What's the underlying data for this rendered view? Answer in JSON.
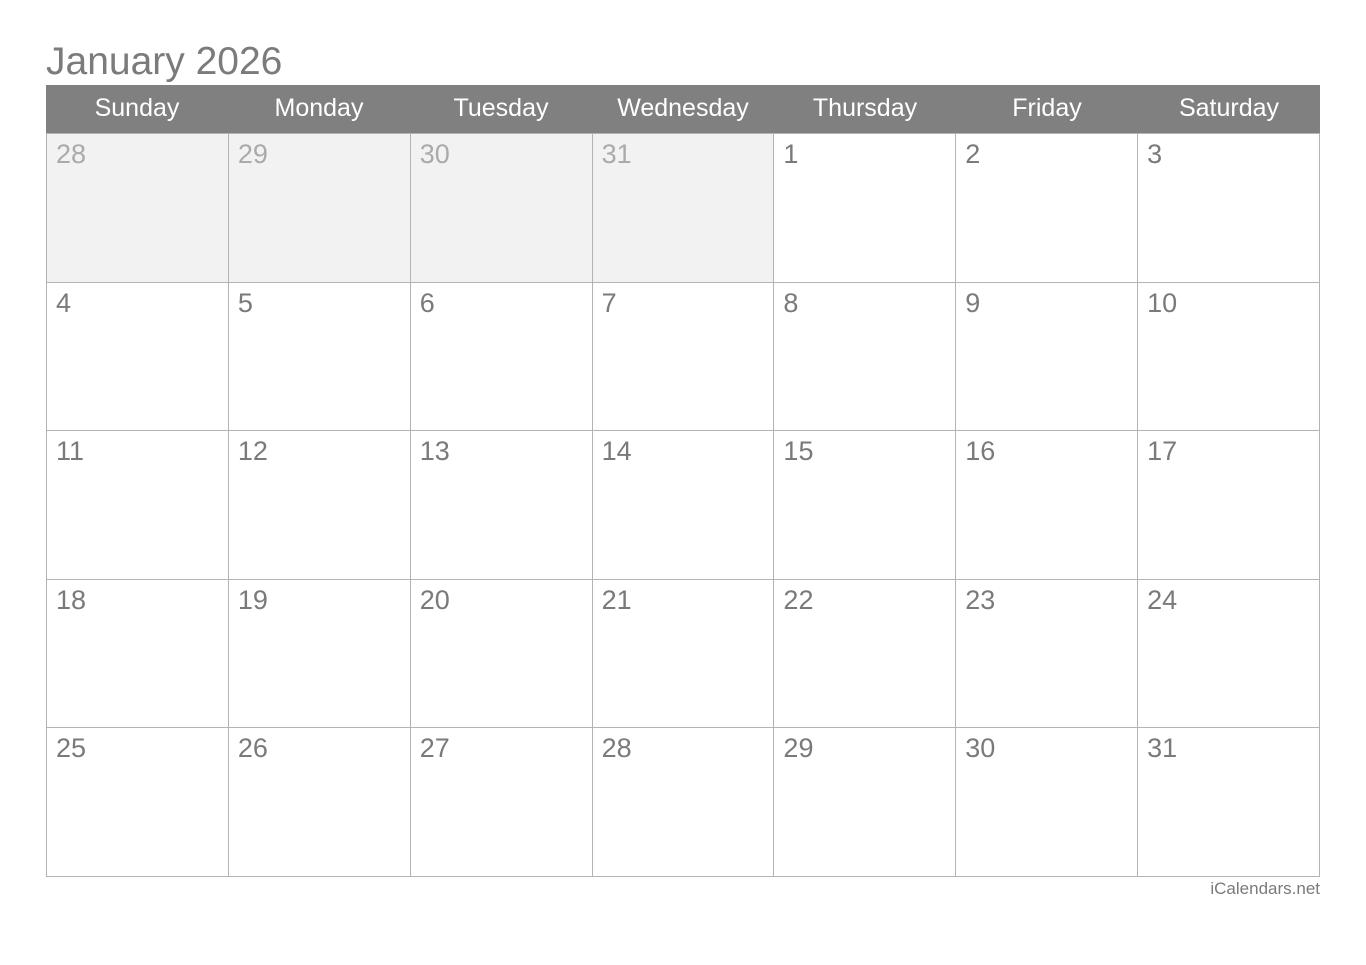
{
  "title": "January 2026",
  "weekdays": [
    "Sunday",
    "Monday",
    "Tuesday",
    "Wednesday",
    "Thursday",
    "Friday",
    "Saturday"
  ],
  "weeks": [
    [
      {
        "day": "28",
        "other": true
      },
      {
        "day": "29",
        "other": true
      },
      {
        "day": "30",
        "other": true
      },
      {
        "day": "31",
        "other": true
      },
      {
        "day": "1"
      },
      {
        "day": "2"
      },
      {
        "day": "3"
      }
    ],
    [
      {
        "day": "4"
      },
      {
        "day": "5"
      },
      {
        "day": "6"
      },
      {
        "day": "7"
      },
      {
        "day": "8"
      },
      {
        "day": "9"
      },
      {
        "day": "10"
      }
    ],
    [
      {
        "day": "11"
      },
      {
        "day": "12"
      },
      {
        "day": "13"
      },
      {
        "day": "14"
      },
      {
        "day": "15"
      },
      {
        "day": "16"
      },
      {
        "day": "17"
      }
    ],
    [
      {
        "day": "18"
      },
      {
        "day": "19"
      },
      {
        "day": "20"
      },
      {
        "day": "21"
      },
      {
        "day": "22"
      },
      {
        "day": "23"
      },
      {
        "day": "24"
      }
    ],
    [
      {
        "day": "25"
      },
      {
        "day": "26"
      },
      {
        "day": "27"
      },
      {
        "day": "28"
      },
      {
        "day": "29"
      },
      {
        "day": "30"
      },
      {
        "day": "31"
      }
    ]
  ],
  "footer": "iCalendars.net"
}
